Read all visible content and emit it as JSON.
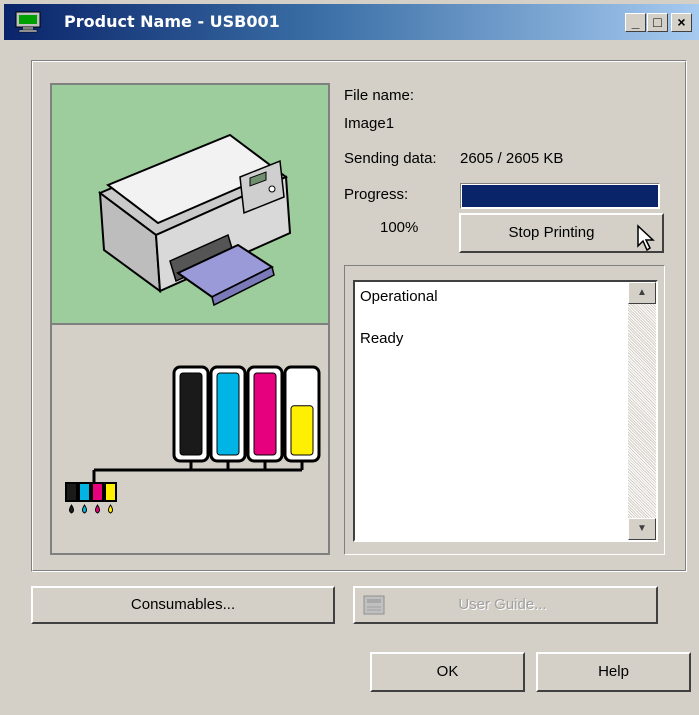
{
  "window": {
    "title": "Product Name - USB001",
    "minimize_glyph": "_",
    "maximize_glyph": "□",
    "close_glyph": "×"
  },
  "job": {
    "file_name_label": "File name:",
    "file_name": "Image1",
    "sending_label": "Sending data:",
    "sending_value": "2605 / 2605 KB",
    "progress_label": "Progress:",
    "progress_percent_text": "100%",
    "progress_fraction": 1.0
  },
  "buttons": {
    "stop_printing": "Stop Printing",
    "consumables": "Consumables...",
    "user_guide": "User Guide...",
    "ok": "OK",
    "help": "Help"
  },
  "status": {
    "lines": [
      "Operational",
      "Ready"
    ]
  },
  "ink": {
    "colors": [
      "#1a1a1a",
      "#00b4e6",
      "#e6007e",
      "#ffef00"
    ],
    "levels": [
      1.0,
      1.0,
      1.0,
      0.6
    ]
  },
  "theme": {
    "printer_bg": "#9dcc9d",
    "progress_fill": "#0a246a",
    "title_gradient_start": "#0a246a"
  },
  "icons": [
    "computer-icon",
    "printer-icon",
    "ink-cartridge-icon",
    "book-icon",
    "mouse-pointer-icon",
    "scroll-up-icon",
    "scroll-down-icon"
  ]
}
